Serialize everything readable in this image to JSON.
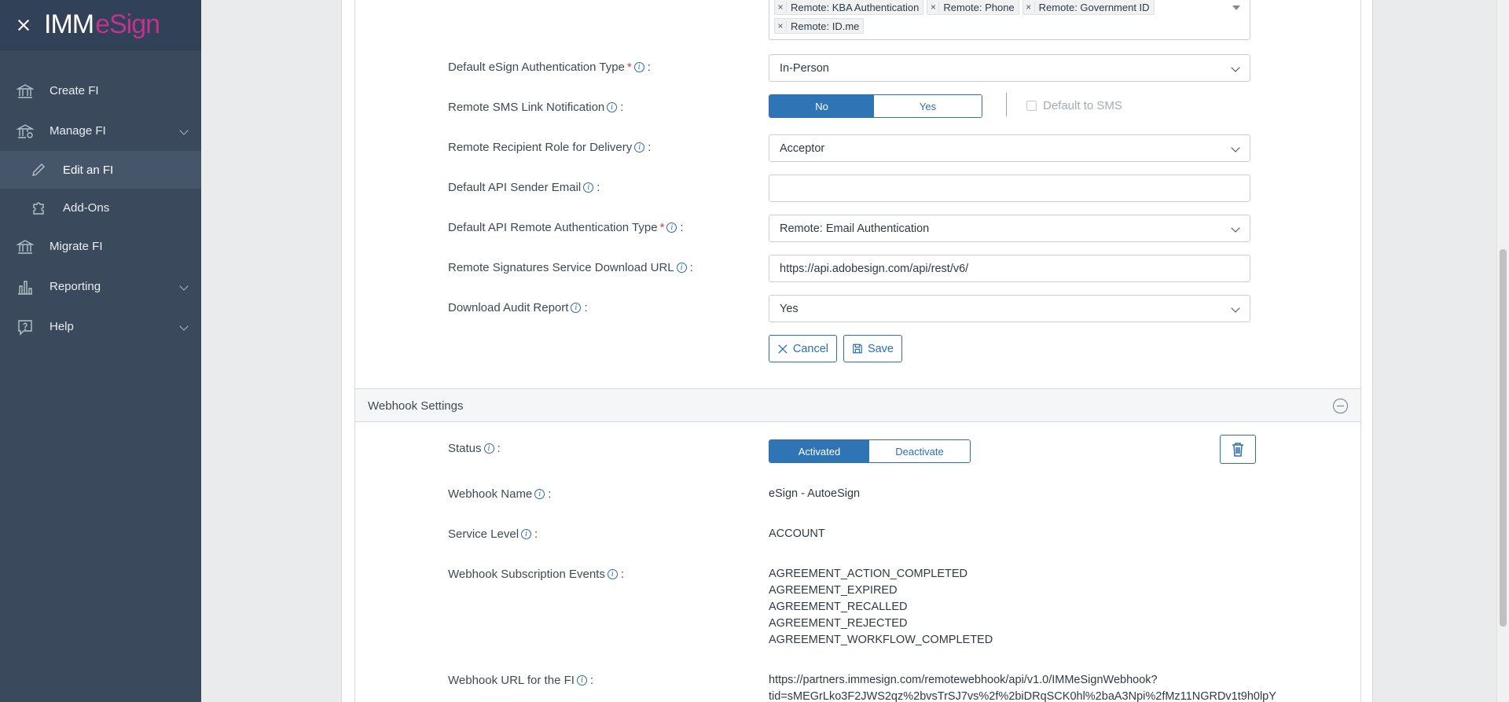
{
  "brand": {
    "imm": "IMM",
    "esign": "eSign"
  },
  "nav": {
    "create_fi": "Create FI",
    "manage_fi": "Manage FI",
    "edit_fi": "Edit an FI",
    "add_ons": "Add-Ons",
    "migrate_fi": "Migrate FI",
    "reporting": "Reporting",
    "help": "Help"
  },
  "form": {
    "auth_tags": [
      "Remote: KBA Authentication",
      "Remote: Phone",
      "Remote: Government ID",
      "Remote: ID.me"
    ],
    "tag_remove": "×",
    "default_auth_label": "Default eSign Authentication Type",
    "default_auth_value": "In-Person",
    "sms_label": "Remote SMS Link Notification",
    "sms_no": "No",
    "sms_yes": "Yes",
    "sms_default": "Default to SMS",
    "recipient_label": "Remote Recipient Role for Delivery",
    "recipient_value": "Acceptor",
    "api_sender_label": "Default API Sender Email",
    "api_sender_value": "",
    "api_auth_label": "Default API Remote Authentication Type",
    "api_auth_value": "Remote: Email Authentication",
    "download_url_label": "Remote Signatures Service Download URL",
    "download_url_value": "https://api.adobesign.com/api/rest/v6/",
    "audit_label": "Download Audit Report",
    "audit_value": "Yes",
    "cancel": "Cancel",
    "save": "Save",
    "required_mark": "*",
    "colon": ":",
    "info_glyph": "i"
  },
  "webhook": {
    "section_title": "Webhook Settings",
    "status_label": "Status",
    "status_on": "Activated",
    "status_off": "Deactivate",
    "name_label": "Webhook Name",
    "name_value": "eSign - AutoeSign",
    "level_label": "Service Level",
    "level_value": "ACCOUNT",
    "events_label": "Webhook Subscription Events",
    "events": [
      "AGREEMENT_ACTION_COMPLETED",
      "AGREEMENT_EXPIRED",
      "AGREEMENT_RECALLED",
      "AGREEMENT_REJECTED",
      "AGREEMENT_WORKFLOW_COMPLETED"
    ],
    "url_label": "Webhook URL for the FI",
    "url_line1": "https://partners.immesign.com/remotewebhook/api/v1.0/IMMeSignWebhook?",
    "url_line2": "tid=sMEGrLko3F2JWS2qz%2bvsTrSJ7vs%2f%2biDRqSCK0hl%2baA3Npi%2fMz11NGRDv1t9h0lpY"
  },
  "colors": {
    "sidebar": "#3a4a5c",
    "accent": "#2f74b5",
    "brand_pink": "#c0338f",
    "required": "#d13a3a"
  }
}
